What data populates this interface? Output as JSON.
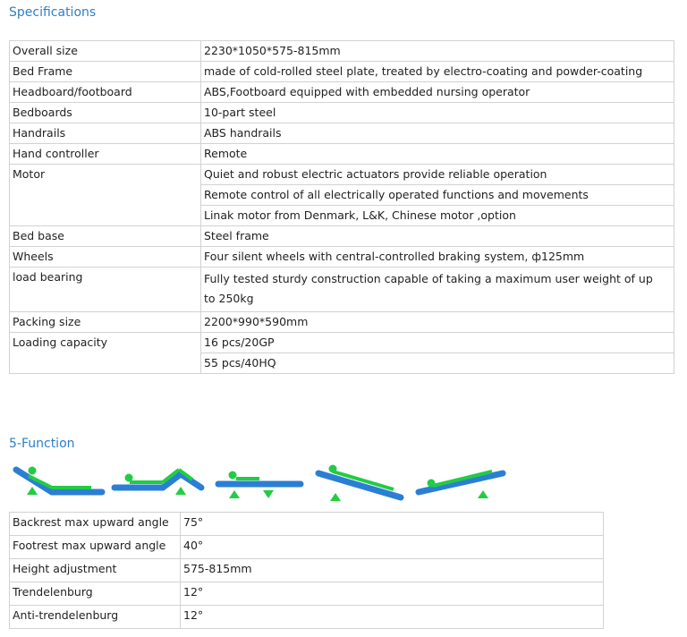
{
  "specifications_title": "Specifications",
  "spec_rows": [
    {
      "label": "Overall size",
      "value": "2230*1050*575-815mm"
    },
    {
      "label": "Bed Frame",
      "value": "made of cold-rolled steel plate, treated by electro-coating and powder-coating"
    },
    {
      "label": "Headboard/footboard",
      "value": "ABS,Footboard equipped with embedded nursing operator"
    },
    {
      "label": "Bedboards",
      "value": "10-part steel"
    },
    {
      "label": "Handrails",
      "value": "ABS handrails"
    },
    {
      "label": "Hand controller",
      "value": "Remote"
    },
    {
      "label": "Motor",
      "values": [
        "Quiet and robust electric actuators provide reliable operation",
        "Remote control of all electrically operated functions and movements",
        "Linak motor from Denmark, L&K, Chinese motor ,option"
      ]
    },
    {
      "label": "Bed base",
      "value": "Steel frame"
    },
    {
      "label": "Wheels",
      "value": "Four silent wheels with central-controlled braking system, ф125mm"
    },
    {
      "label": "load bearing",
      "value": "Fully tested sturdy construction capable of taking a maximum user weight of up to 250kg"
    },
    {
      "label": "Packing size",
      "value": "2200*990*590mm"
    },
    {
      "label": "Loading capacity",
      "values": [
        "16 pcs/20GP",
        "55 pcs/40HQ"
      ]
    }
  ],
  "function_title": "5-Function",
  "function_icons": [
    "backrest-up-icon",
    "knee-break-icon",
    "height-adjust-icon",
    "trendelenburg-icon",
    "anti-trendelenburg-icon"
  ],
  "colors": {
    "bed_frame": "#2a7fd4",
    "patient_and_arrows": "#22cc44",
    "title": "#2f7fc4",
    "border": "#d2d2d2"
  },
  "function_rows": [
    {
      "label": "Backrest max upward angle",
      "value": "75°"
    },
    {
      "label": "Footrest max upward angle",
      "value": "40°"
    },
    {
      "label": "Height adjustment",
      "value": "575-815mm"
    },
    {
      "label": "Trendelenburg",
      "value": "12°"
    },
    {
      "label": "Anti-trendelenburg",
      "value": "12°"
    }
  ]
}
